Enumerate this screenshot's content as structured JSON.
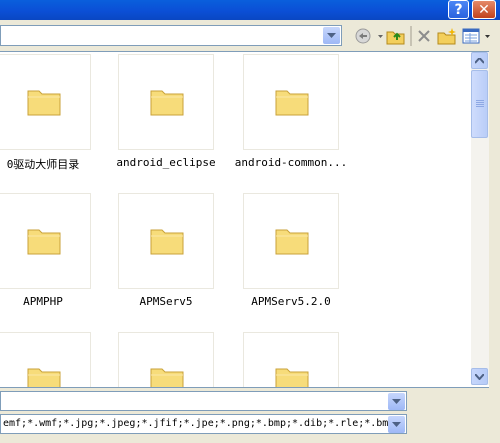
{
  "window": {
    "help_label": "?",
    "close_label": "✕"
  },
  "toolbar": {
    "lookin_value": "",
    "icons": [
      "back-icon",
      "up-folder-icon",
      "delete-icon",
      "new-folder-icon",
      "view-menu-icon"
    ]
  },
  "files": [
    {
      "label": "0驱动大师目录"
    },
    {
      "label": "android_eclipse"
    },
    {
      "label": "android-common..."
    },
    {
      "label": "APMPHP"
    },
    {
      "label": "APMServ5"
    },
    {
      "label": "APMServ5.2.0"
    },
    {
      "label": ""
    },
    {
      "label": ""
    },
    {
      "label": ""
    }
  ],
  "filename_field": {
    "value": ""
  },
  "filetype_field": {
    "value": "emf;*.wmf;*.jpg;*.jpeg;*.jfif;*.jpe;*.png;*.bmp;*.dib;*.rle;*.bm"
  },
  "colors": {
    "folder": "#f5d76e",
    "accent": "#0b4fd6"
  }
}
